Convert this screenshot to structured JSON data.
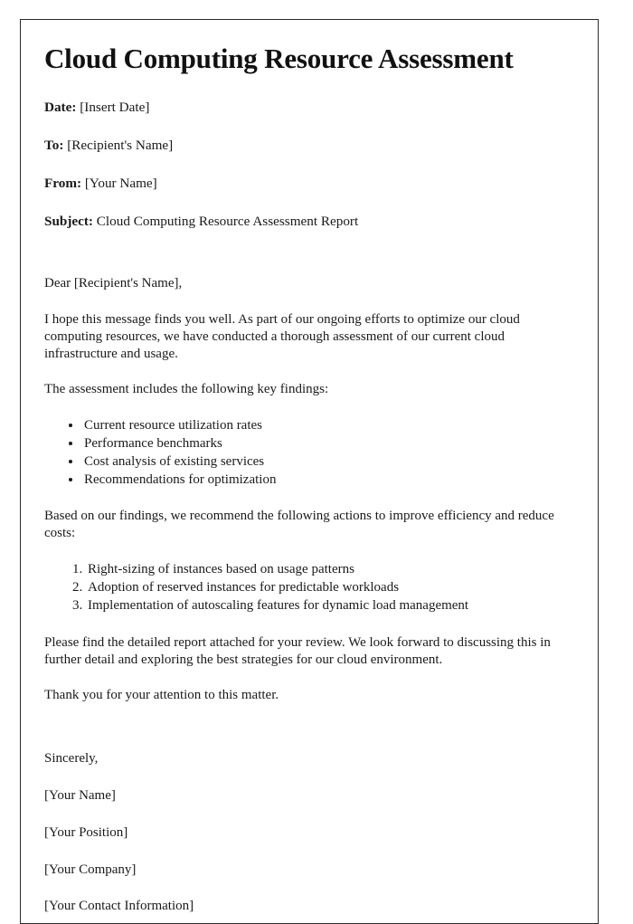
{
  "document": {
    "title": "Cloud Computing Resource Assessment",
    "header_fields": [
      {
        "label": "Date:",
        "value": "[Insert Date]"
      },
      {
        "label": "To:",
        "value": "[Recipient's Name]"
      },
      {
        "label": "From:",
        "value": "[Your Name]"
      },
      {
        "label": "Subject:",
        "value": "Cloud Computing Resource Assessment Report"
      }
    ],
    "salutation": "Dear [Recipient's Name],",
    "paragraphs": {
      "intro": "I hope this message finds you well. As part of our ongoing efforts to optimize our cloud computing resources, we have conducted a thorough assessment of our current cloud infrastructure and usage.",
      "findings_lead": "The assessment includes the following key findings:",
      "actions_lead": "Based on our findings, we recommend the following actions to improve efficiency and reduce costs:",
      "attachment": "Please find the detailed report attached for your review. We look forward to discussing this in further detail and exploring the best strategies for our cloud environment.",
      "thanks": "Thank you for your attention to this matter."
    },
    "findings_list": [
      "Current resource utilization rates",
      "Performance benchmarks",
      "Cost analysis of existing services",
      "Recommendations for optimization"
    ],
    "actions_list": [
      "Right-sizing of instances based on usage patterns",
      "Adoption of reserved instances for predictable workloads",
      "Implementation of autoscaling features for dynamic load management"
    ],
    "closing": {
      "valediction": "Sincerely,",
      "name": "[Your Name]",
      "position": "[Your Position]",
      "company": "[Your Company]",
      "contact": "[Your Contact Information]"
    }
  },
  "colors": {
    "page_background": "#ffffff",
    "border": "#2b2b2b",
    "text": "#1a1a1a",
    "title_text": "#111111"
  }
}
